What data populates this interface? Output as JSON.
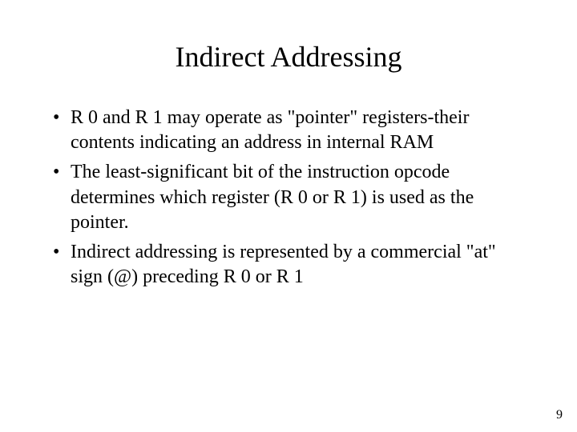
{
  "slide": {
    "title": "Indirect Addressing",
    "bullets": [
      "R 0 and R 1 may operate as \"pointer\" registers-their contents indicating an address in internal RAM",
      "The least-significant bit of the instruction opcode determines which register (R 0 or R 1) is used as the pointer.",
      "Indirect addressing is represented by a commercial \"at\" sign (@) preceding R 0 or R 1"
    ],
    "page_number": "9"
  }
}
